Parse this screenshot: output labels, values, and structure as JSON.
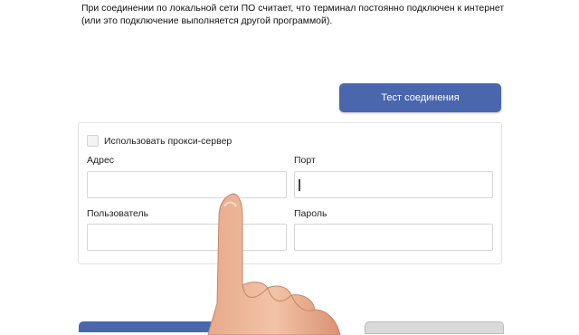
{
  "notice": {
    "line1": "При соединении по локальной сети ПО считает, что терминал постоянно подключен к интернет",
    "line2": "(или это подключение выполняется другой программой)."
  },
  "test_button": {
    "label": "Тест соединения"
  },
  "proxy": {
    "checkbox_label": "Использовать прокси-сервер",
    "checked": false,
    "address_label": "Адрес",
    "address_value": "",
    "port_label": "Порт",
    "port_value": "",
    "user_label": "Пользователь",
    "user_value": "",
    "password_label": "Пароль",
    "password_value": ""
  },
  "colors": {
    "accent": "#4a67ae",
    "border": "#d6d6d6"
  },
  "icons": {
    "overlay": "pointing-hand-icon"
  }
}
